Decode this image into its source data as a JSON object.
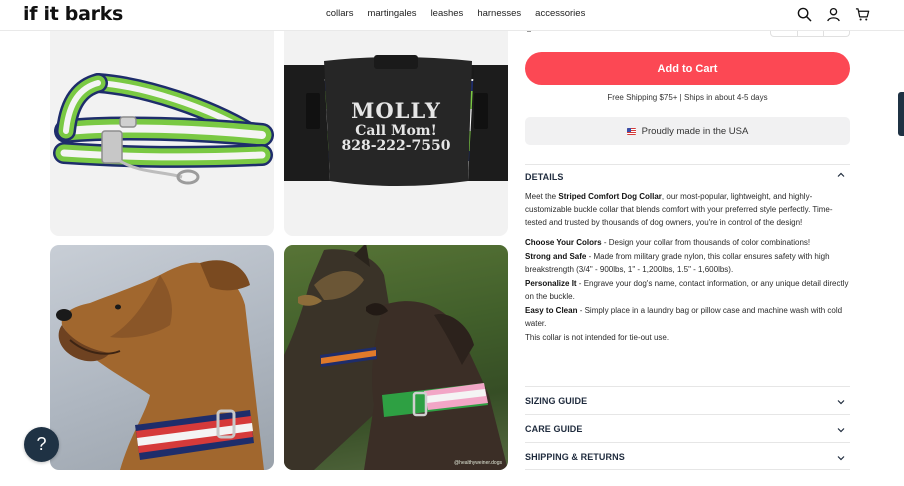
{
  "header": {
    "logo": "if it barks",
    "nav": [
      "collars",
      "martingales",
      "leashes",
      "harnesses",
      "accessories"
    ],
    "icons": [
      "search-icon",
      "account-icon",
      "cart-icon"
    ]
  },
  "gallery": {
    "buckle_name": "MOLLY",
    "buckle_line2": "Call Mom!",
    "buckle_phone": "828-222-7550",
    "photo_credit": "@healthyweiner.dogs"
  },
  "purchase": {
    "add_to_cart": "Add to Cart",
    "shipping_note": "Free Shipping $75+ | Ships in about 4-5 days",
    "made_in": "Proudly made in the USA"
  },
  "details": {
    "title": "DETAILS",
    "intro_pre": "Meet the ",
    "intro_bold": "Striped Comfort Dog Collar",
    "intro_post": ", our most-popular, lightweight, and highly-customizable buckle collar that blends comfort with your preferred style perfectly. Time-tested and trusted by thousands of dog owners, you're in control of the design!",
    "bullets": [
      {
        "label": "Choose Your Colors",
        "text": " - Design your collar from thousands of color combinations!"
      },
      {
        "label": "Strong and Safe",
        "text": " - Made from military grade nylon, this collar ensures safety with high breakstrength (3/4\" - 900lbs, 1\" - 1,200lbs, 1.5\" - 1,600lbs)."
      },
      {
        "label": "Personalize It",
        "text": " - Engrave your dog's name, contact information, or any unique detail directly on the buckle."
      },
      {
        "label": "Easy to Clean",
        "text": " - Simply place in a laundry bag or pillow case and machine wash with cold water."
      }
    ],
    "note": "This collar is not intended for tie-out use."
  },
  "accordions": [
    "SIZING GUIDE",
    "CARE GUIDE",
    "SHIPPING & RETURNS"
  ],
  "help_button": "?",
  "colors": {
    "accent_red": "#fc4854",
    "navy": "#1f3244",
    "stripe_green": "#7ac943",
    "stripe_navy": "#1e2d6b"
  }
}
